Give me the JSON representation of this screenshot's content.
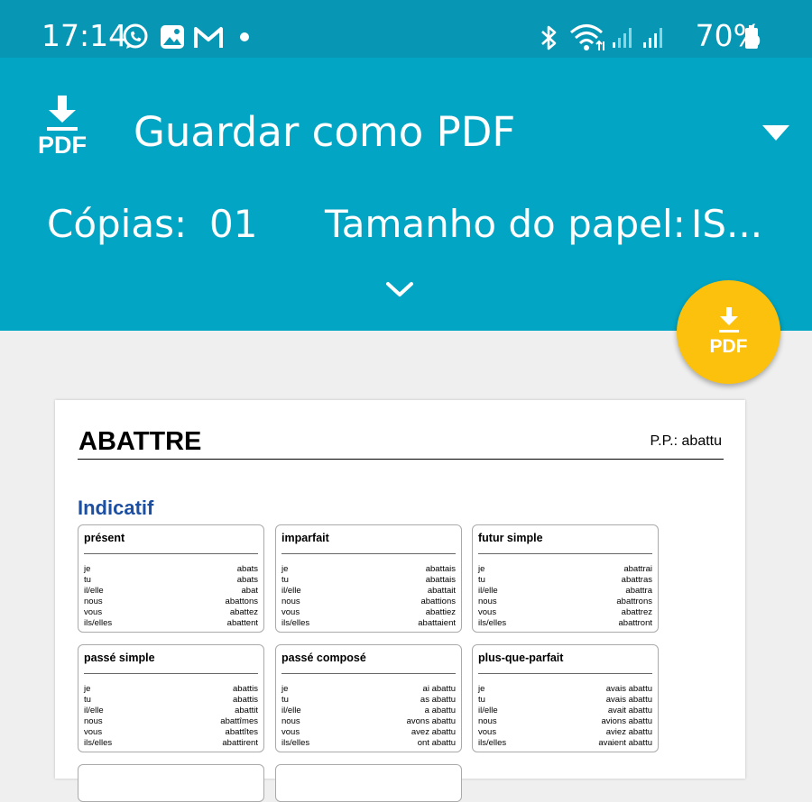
{
  "status_bar": {
    "time": "17:14",
    "battery": "70%",
    "left_icons": [
      "whatsapp-icon",
      "gallery-icon",
      "gmail-icon",
      "dot-icon"
    ],
    "right_icons": [
      "bluetooth-icon",
      "wifi-icon",
      "signal-icon",
      "signal-icon",
      "battery-icon"
    ]
  },
  "header": {
    "printer_icon_label": "PDF",
    "printer_name": "Guardar como PDF",
    "copies_label": "Cópias:",
    "copies_value": "01",
    "paper_size_label": "Tamanho do papel:",
    "paper_size_value": "IS...",
    "accent_color": "#02a5c3"
  },
  "fab": {
    "label": "PDF",
    "color": "#fcc10c"
  },
  "document": {
    "verb": "ABATTRE",
    "past_participle": "P.P.: abattu",
    "mood": "Indicatif",
    "tenses": [
      {
        "name": "présent",
        "rows": [
          {
            "pronoun": "je",
            "form": "abats"
          },
          {
            "pronoun": "tu",
            "form": "abats"
          },
          {
            "pronoun": "il/elle",
            "form": "abat"
          },
          {
            "pronoun": "nous",
            "form": "abattons"
          },
          {
            "pronoun": "vous",
            "form": "abattez"
          },
          {
            "pronoun": "ils/elles",
            "form": "abattent"
          }
        ]
      },
      {
        "name": "imparfait",
        "rows": [
          {
            "pronoun": "je",
            "form": "abattais"
          },
          {
            "pronoun": "tu",
            "form": "abattais"
          },
          {
            "pronoun": "il/elle",
            "form": "abattait"
          },
          {
            "pronoun": "nous",
            "form": "abattions"
          },
          {
            "pronoun": "vous",
            "form": "abattiez"
          },
          {
            "pronoun": "ils/elles",
            "form": "abattaient"
          }
        ]
      },
      {
        "name": "futur simple",
        "rows": [
          {
            "pronoun": "je",
            "form": "abattrai"
          },
          {
            "pronoun": "tu",
            "form": "abattras"
          },
          {
            "pronoun": "il/elle",
            "form": "abattra"
          },
          {
            "pronoun": "nous",
            "form": "abattrons"
          },
          {
            "pronoun": "vous",
            "form": "abattrez"
          },
          {
            "pronoun": "ils/elles",
            "form": "abattront"
          }
        ]
      },
      {
        "name": "passé simple",
        "rows": [
          {
            "pronoun": "je",
            "form": "abattis"
          },
          {
            "pronoun": "tu",
            "form": "abattis"
          },
          {
            "pronoun": "il/elle",
            "form": "abattit"
          },
          {
            "pronoun": "nous",
            "form": "abattîmes"
          },
          {
            "pronoun": "vous",
            "form": "abattîtes"
          },
          {
            "pronoun": "ils/elles",
            "form": "abattirent"
          }
        ]
      },
      {
        "name": "passé composé",
        "rows": [
          {
            "pronoun": "je",
            "form": "ai abattu"
          },
          {
            "pronoun": "tu",
            "form": "as abattu"
          },
          {
            "pronoun": "il/elle",
            "form": "a abattu"
          },
          {
            "pronoun": "nous",
            "form": "avons abattu"
          },
          {
            "pronoun": "vous",
            "form": "avez abattu"
          },
          {
            "pronoun": "ils/elles",
            "form": "ont abattu"
          }
        ]
      },
      {
        "name": "plus-que-parfait",
        "rows": [
          {
            "pronoun": "je",
            "form": "avais abattu"
          },
          {
            "pronoun": "tu",
            "form": "avais abattu"
          },
          {
            "pronoun": "il/elle",
            "form": "avait abattu"
          },
          {
            "pronoun": "nous",
            "form": "avions abattu"
          },
          {
            "pronoun": "vous",
            "form": "aviez abattu"
          },
          {
            "pronoun": "ils/elles",
            "form": "avaient abattu"
          }
        ]
      }
    ]
  }
}
